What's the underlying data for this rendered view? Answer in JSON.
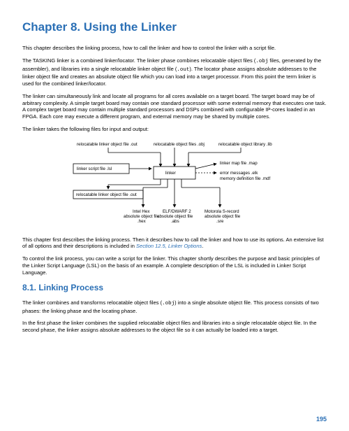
{
  "chapter_title": "Chapter 8. Using the Linker",
  "p1": "This chapter describes the linking process, how to call the linker and how to control the linker with a script file.",
  "p2_a": "The TASKING linker is a combined linker/locator. The linker phase combines relocatable object files (",
  "p2_code1": ".obj",
  "p2_b": " files, generated by the assembler), and libraries into a single relocatable linker object file (",
  "p2_code2": ".out",
  "p2_c": "). The locator phase assigns absolute addresses to the linker object file and creates an absolute object file which you can load into a target processor. From this point the term linker is used for the combined linker/locator.",
  "p3": "The linker can simultaneously link and locate all programs for all cores available on a target board. The target board may be of arbitrary complexity. A simple target board may contain one standard processor with some external memory that executes one task. A complex target board may contain multiple standard processors and DSPs combined with configurable IP-cores loaded in an FPGA. Each core may execute a different program, and external memory may be shared by multiple cores.",
  "p4": "The linker takes the following files for input and output:",
  "diagram": {
    "top_left": "relocatable linker object file .out",
    "top_mid": "relocatable object files .obj",
    "top_right": "relocatable object library .lib",
    "left_box": "linker script file .lsl",
    "center_box": "linker",
    "right1": "linker map file .map",
    "right2": "error messages .elk",
    "right3": "memory definition file .mdf",
    "bottom_out": "relocatable linker object file .out",
    "b1a": "Intel Hex",
    "b1b": "absolute object file",
    "b1c": ".hex",
    "b2a": "ELF/DWARF 2",
    "b2b": "absolute object file",
    "b2c": ".abs",
    "b3a": "Motorola S-record",
    "b3b": "absolute object file",
    "b3c": ".sre"
  },
  "p5_a": "This chapter first describes the linking process. Then it describes how to call the linker and how to use its options. An extensive list of all options and their descriptions is included in ",
  "p5_link": "Section 12.5, Linker Options",
  "p5_b": ".",
  "p6": "To control the link process, you can write a script for the linker. This chapter shortly describes the purpose and basic principles of the Linker Script Language (LSL) on the basis of an example. A complete description of the LSL is included in Linker Script Language.",
  "section_title": "8.1. Linking Process",
  "p7_a": "The linker combines and transforms relocatable object files (",
  "p7_code": ".obj",
  "p7_b": ") into a single absolute object file. This process consists of two phases: the linking phase and the locating phase.",
  "p8": "In the first phase the linker combines the supplied relocatable object files and libraries into a single relocatable object file. In the second phase, the linker assigns absolute addresses to the object file so it can actually be loaded into a target.",
  "page_number": "195"
}
